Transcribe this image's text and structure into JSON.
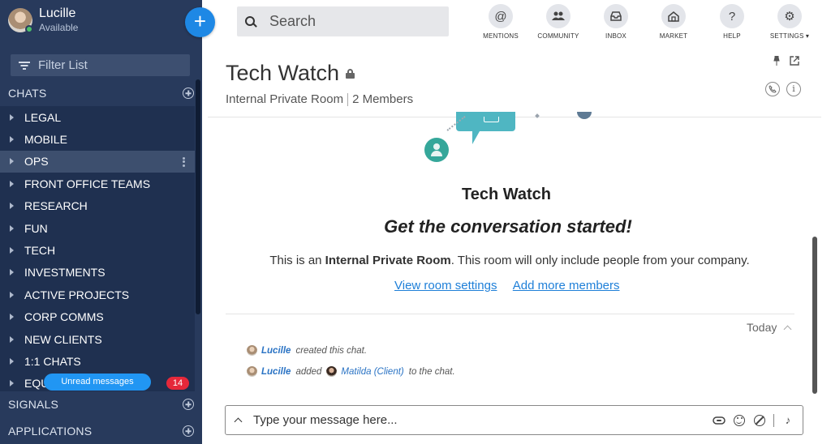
{
  "user": {
    "name": "Lucille",
    "status": "Available"
  },
  "sidebar": {
    "filter_placeholder": "Filter List",
    "chats_header": "CHATS",
    "chats": [
      {
        "label": "LEGAL"
      },
      {
        "label": "MOBILE"
      },
      {
        "label": "OPS",
        "selected": true
      },
      {
        "label": "FRONT OFFICE TEAMS"
      },
      {
        "label": "RESEARCH"
      },
      {
        "label": "FUN"
      },
      {
        "label": "TECH"
      },
      {
        "label": "INVESTMENTS"
      },
      {
        "label": "ACTIVE PROJECTS"
      },
      {
        "label": "CORP COMMS"
      },
      {
        "label": "NEW CLIENTS"
      },
      {
        "label": "1:1 CHATS"
      },
      {
        "label": "EQU"
      }
    ],
    "unread_pill": "Unread messages",
    "unread_count": "14",
    "signals_header": "SIGNALS",
    "applications_header": "APPLICATIONS"
  },
  "topbar": {
    "search_placeholder": "Search",
    "nav": [
      {
        "label": "MENTIONS",
        "icon": "@"
      },
      {
        "label": "COMMUNITY",
        "icon": "people"
      },
      {
        "label": "INBOX",
        "icon": "inbox"
      },
      {
        "label": "MARKET",
        "icon": "market"
      },
      {
        "label": "HELP",
        "icon": "?"
      },
      {
        "label": "SETTINGS ▾",
        "icon": "gear"
      }
    ]
  },
  "room": {
    "title": "Tech Watch",
    "type": "Internal Private Room",
    "members": "2 Members"
  },
  "empty_state": {
    "title": "Tech Watch",
    "tagline": "Get the conversation started!",
    "desc_prefix": "This is an ",
    "desc_bold": "Internal Private Room",
    "desc_suffix": ". This room will only include people from your company.",
    "link_settings": "View room settings",
    "link_members": "Add more members"
  },
  "messages": {
    "date_label": "Today",
    "created": {
      "user": "Lucille",
      "text": "created this chat."
    },
    "added": {
      "user": "Lucille",
      "verb": "added",
      "target": "Matilda (Client)",
      "suffix": "to the chat."
    }
  },
  "composer": {
    "placeholder": "Type your message here..."
  },
  "colors": {
    "sidebar": "#283a5c",
    "accent": "#1e88e5",
    "link": "#1e7fd8",
    "badge": "#e5283a"
  }
}
